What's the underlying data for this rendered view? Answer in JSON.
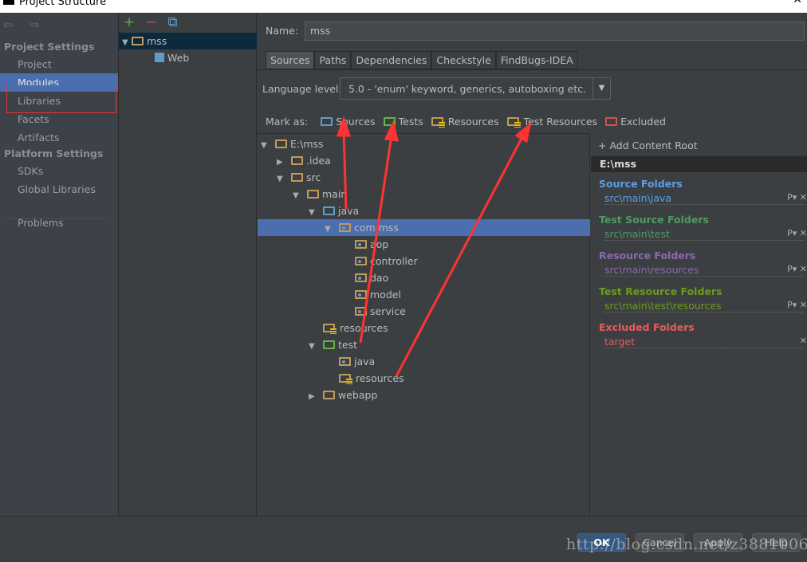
{
  "window": {
    "title": "Project Structure",
    "close": "✕"
  },
  "sidebar": {
    "nav": "⇦ ⇨",
    "project_settings": "Project Settings",
    "platform_settings": "Platform Settings",
    "items": [
      {
        "label": "Project"
      },
      {
        "label": "Modules"
      },
      {
        "label": "Libraries"
      },
      {
        "label": "Facets"
      },
      {
        "label": "Artifacts"
      },
      {
        "label": "SDKs"
      },
      {
        "label": "Global Libraries"
      },
      {
        "label": "Problems"
      }
    ],
    "selected": "Modules"
  },
  "modules": {
    "add": "+",
    "remove": "−",
    "copy": "⧉",
    "tree": [
      {
        "label": "mss"
      },
      {
        "label": "Web"
      }
    ]
  },
  "main": {
    "name_label": "Name:",
    "name_value": "mss",
    "tabs": [
      {
        "label": "Sources"
      },
      {
        "label": "Paths"
      },
      {
        "label": "Dependencies"
      },
      {
        "label": "Checkstyle"
      },
      {
        "label": "FindBugs-IDEA"
      }
    ],
    "language_label": "Language level:",
    "language_value": "5.0 - 'enum' keyword, generics, autoboxing etc.",
    "mark_as_label": "Mark as:",
    "mark_as": [
      {
        "label": "Sources"
      },
      {
        "label": "Tests"
      },
      {
        "label": "Resources"
      },
      {
        "label": "Test Resources"
      },
      {
        "label": "Excluded"
      }
    ],
    "tree": [
      {
        "label": "E:\\mss",
        "level": 0,
        "expand": "open",
        "icon": "folder"
      },
      {
        "label": ".idea",
        "level": 1,
        "expand": "closed",
        "icon": "folder"
      },
      {
        "label": "src",
        "level": 1,
        "expand": "open",
        "icon": "folder"
      },
      {
        "label": "main",
        "level": 2,
        "expand": "open",
        "icon": "folder"
      },
      {
        "label": "java",
        "level": 3,
        "expand": "open",
        "icon": "source"
      },
      {
        "label": "com.mss",
        "level": 4,
        "expand": "open",
        "icon": "package",
        "selected": true
      },
      {
        "label": "aop",
        "level": 5,
        "icon": "package"
      },
      {
        "label": "controller",
        "level": 5,
        "icon": "package"
      },
      {
        "label": "dao",
        "level": 5,
        "icon": "package"
      },
      {
        "label": "model",
        "level": 5,
        "icon": "package"
      },
      {
        "label": "service",
        "level": 5,
        "icon": "package"
      },
      {
        "label": "resources",
        "level": 3,
        "icon": "resources"
      },
      {
        "label": "test",
        "level": 3,
        "expand": "open",
        "icon": "test"
      },
      {
        "label": "java",
        "level": 4,
        "icon": "package"
      },
      {
        "label": "resources",
        "level": 4,
        "icon": "resources"
      },
      {
        "label": "webapp",
        "level": 3,
        "expand": "closed",
        "icon": "folder"
      }
    ],
    "content_root": {
      "add": "+ Add Content Root",
      "root": "E:\\mss",
      "groups": [
        {
          "title": "Source Folders",
          "path": "src\\main\\java",
          "color": "#5c9ee6"
        },
        {
          "title": "Test Source Folders",
          "path": "src\\main\\test",
          "color": "#4e9a64"
        },
        {
          "title": "Resource Folders",
          "path": "src\\main\\resources",
          "color": "#8b6bab"
        },
        {
          "title": "Test Resource Folders",
          "path": "src\\main\\test\\resources",
          "color": "#6f9a1c"
        },
        {
          "title": "Excluded Folders",
          "path": "target",
          "color": "#e55b5b"
        }
      ]
    }
  },
  "buttons": {
    "ok": "OK",
    "cancel": "Cancel",
    "apply": "Apply",
    "help": "Help"
  },
  "watermark": "http://blog.csdn.net/z3881006",
  "colors": {
    "selection": "#4b6eaf",
    "annotation": "#ff3333"
  }
}
